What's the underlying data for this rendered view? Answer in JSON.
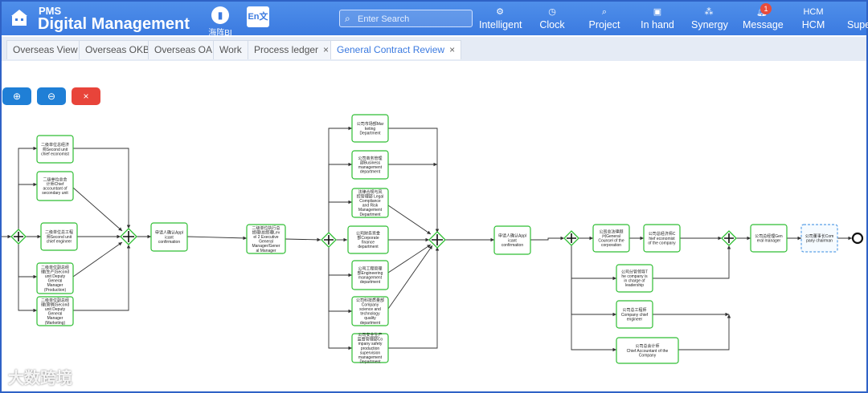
{
  "app": {
    "brand_top": "PMS",
    "brand_main": "Digital Management",
    "bi_label": "海阵BI",
    "lang_icon": "En文"
  },
  "search": {
    "placeholder": "Enter Search"
  },
  "nav": [
    {
      "label": "Intelligent",
      "icon": "gear-icon"
    },
    {
      "label": "Clock",
      "icon": "clock-icon"
    },
    {
      "label": "Project",
      "icon": "search-icon"
    },
    {
      "label": "In hand",
      "icon": "inbox-icon"
    },
    {
      "label": "Synergy",
      "icon": "network-icon"
    },
    {
      "label": "Message",
      "icon": "bell-icon",
      "badge": "1"
    },
    {
      "label": "HCM",
      "top": "HCM"
    },
    {
      "label": "Supe"
    }
  ],
  "tabs": [
    {
      "label": "Overseas View"
    },
    {
      "label": "Overseas OKB"
    },
    {
      "label": "Overseas OA"
    },
    {
      "label": "Work"
    },
    {
      "label": "Process ledger",
      "closable": "×"
    },
    {
      "label": "General Contract Review",
      "closable": "×",
      "active": true
    }
  ],
  "toolbar": {
    "zoom_in": "⊕",
    "zoom_out": "⊖",
    "close": "×"
  },
  "nodes": {
    "n1": [
      "二级单位总经济",
      "师Second unit",
      "chief economist"
    ],
    "n2": [
      "二级单位总会",
      "计师Chief",
      "accountant of",
      "secondary unit"
    ],
    "n3": [
      "二级单位总工程",
      "师Second unit",
      "chief engineer"
    ],
    "n4": [
      "二级单位副总经",
      "理(生产)Second",
      "unit Deputy",
      "General",
      "Manager",
      "(Production)"
    ],
    "n5": [
      "二级单位副总经",
      "理(营销)Second",
      "unit Deputy",
      "General",
      "Manager",
      "(Marketing)"
    ],
    "n6": [
      "申请人确认Appl",
      "icant",
      "confirmation"
    ],
    "n7": [
      "二级单位执行总",
      "经理/总经理Lev",
      "el 2 Executive",
      "General",
      "Manager/Gener",
      "al Manager"
    ],
    "m1": [
      "公司市场部Mar",
      "keting",
      "Department"
    ],
    "m2": [
      "公司商务管理",
      "部Business",
      "management",
      "department"
    ],
    "m3": [
      "法律合规与风",
      "控管理部 Legal",
      "Compliance",
      "and Risk",
      "Management",
      "Department"
    ],
    "m4": [
      "公司财务资金",
      "部Corporate",
      "finance",
      "department"
    ],
    "m5": [
      "公司工程管理",
      "部Engineering",
      "management",
      "department"
    ],
    "m6": [
      "公司科技质量部",
      "Company",
      "science and",
      "technology",
      "quality",
      "department"
    ],
    "m7": [
      "公司安全生产",
      "监督管理部Co",
      "mpany safety",
      "production",
      "supervision",
      "management",
      "Department"
    ],
    "n8": [
      "申请人确认Appl",
      "icant",
      "confirmation"
    ],
    "p1": [
      "公司总法律顾",
      "问General",
      "Counsel of the",
      "corporation"
    ],
    "p2": [
      "公司总经济师C",
      "hief economist",
      "of the company"
    ],
    "p3": [
      "公司分管领导T",
      "he company is",
      "in charge of",
      "leadership"
    ],
    "p4": [
      "公司总工程师",
      "Company chief",
      "engineer"
    ],
    "p5": [
      "公司总会计师",
      "Chief Accountant of the",
      "Company"
    ],
    "q1": [
      "公司总经理Gen",
      "eral manager"
    ],
    "q2": [
      "公司董事长Com",
      "pany chairman"
    ]
  },
  "watermark": "大数跨境"
}
